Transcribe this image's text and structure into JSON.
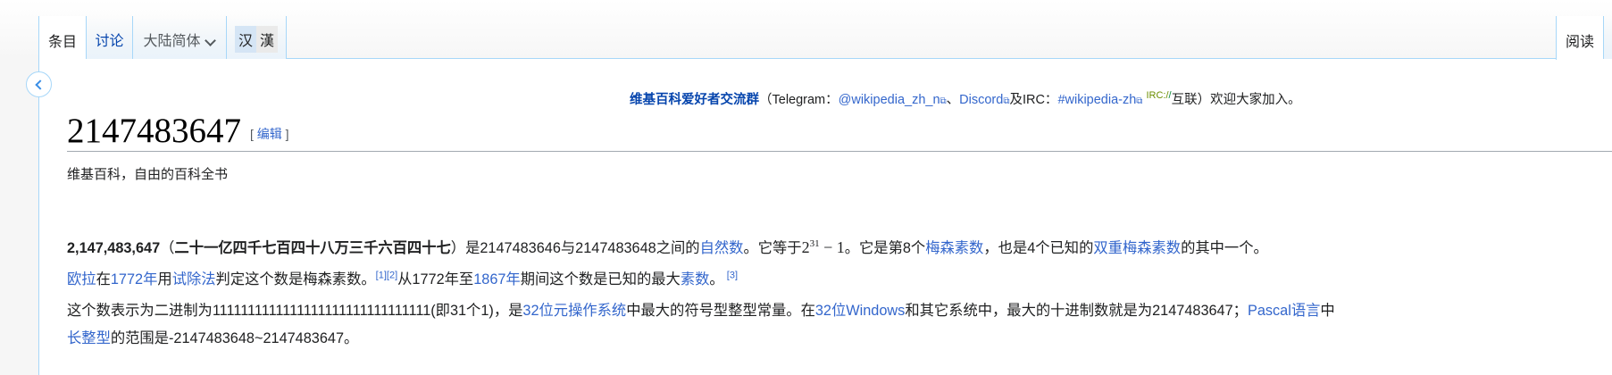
{
  "tabs": {
    "article": "条目",
    "talk": "讨论",
    "variant": "大陆简体",
    "han_simplified": "汉",
    "han_traditional": "漢",
    "read": "阅读"
  },
  "colors": {
    "link": "#3366cc",
    "border": "#a7d7f9"
  },
  "sitenotice": {
    "group": "维基百科爱好者交流群",
    "open": "（Telegram：",
    "telegram": "@wikipedia_zh_n",
    "sep": "、",
    "discord": "Discord",
    "and_irc": "及IRC：",
    "irc_channel": "#wikipedia-zh",
    "irc_a": "IRC:/",
    "irc_b": "/",
    "hulian": "互联）欢迎大家加入。"
  },
  "title": "2147483647",
  "edit": {
    "open": "[ ",
    "label": "编辑",
    "close": " ]"
  },
  "tagline": "维基百科，自由的百科全书",
  "p1": {
    "bold1": "2,147,483,647",
    "open": "（",
    "bold2": "二十一亿四千七百四十八万三千六百四十七",
    "t1": "）是2147483646与2147483648之间的",
    "l1": "自然数",
    "t2": "。它等于",
    "base": "2",
    "exp": "31",
    "minus": " − 1",
    "t3": "。它是第8个",
    "l2": "梅森素数",
    "t4": "，也是4个已知的",
    "l3": "双重梅森素数",
    "t5": "的其中一个。"
  },
  "p2": {
    "l1": "欧拉",
    "t1": "在",
    "l2": "1772年",
    "t2": "用",
    "l3": "试除法",
    "t3": "判定这个数是梅森素数。",
    "r1": "[1]",
    "r2": "[2]",
    "t4": "从1772年至",
    "l4": "1867年",
    "t5": "期间这个数是已知的最大",
    "l5": "素数",
    "t6": "。",
    "r3": "[3]"
  },
  "p3": {
    "t1": "这个数表示为二进制为1111111111111111111111111111111(即31个1)，是",
    "l1": "32位元操作系统",
    "t2": "中最大的符号型整型常量。在",
    "l2": "32位Windows",
    "t3": "和其它系统中，最大的十进制数就是为2147483647；",
    "l3": "Pascal语言",
    "t4": "中",
    "l4": "长整型",
    "t5": "的范围是-2147483648~2147483647。"
  }
}
